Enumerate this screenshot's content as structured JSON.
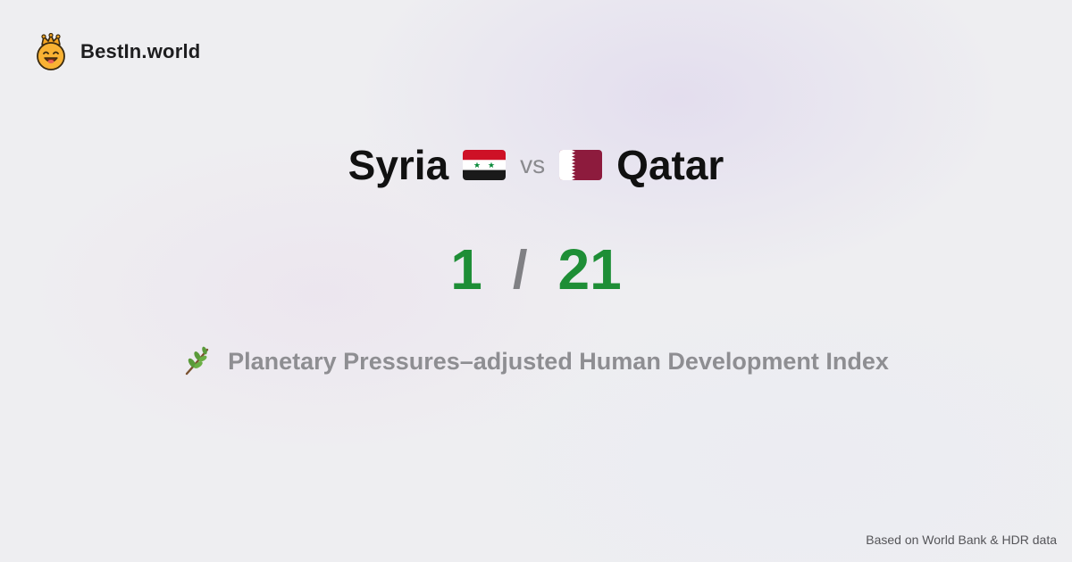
{
  "brand": {
    "name": "BestIn.world",
    "logo_icon": "crowned-smiley-icon"
  },
  "comparison": {
    "left_country": "Syria",
    "left_flag": "syria-flag-icon",
    "vs_label": "vs",
    "right_country": "Qatar",
    "right_flag": "qatar-flag-icon"
  },
  "score": {
    "left_value": "1",
    "separator": "/",
    "right_value": "21"
  },
  "metric": {
    "icon": "plant-branch-icon",
    "label": "Planetary Pressures–adjusted Human Development Index"
  },
  "footer": {
    "source": "Based on World Bank & HDR data"
  },
  "colors": {
    "score_green": "#1e8e36",
    "muted_gray": "#8e8e92",
    "text_dark": "#111111"
  }
}
